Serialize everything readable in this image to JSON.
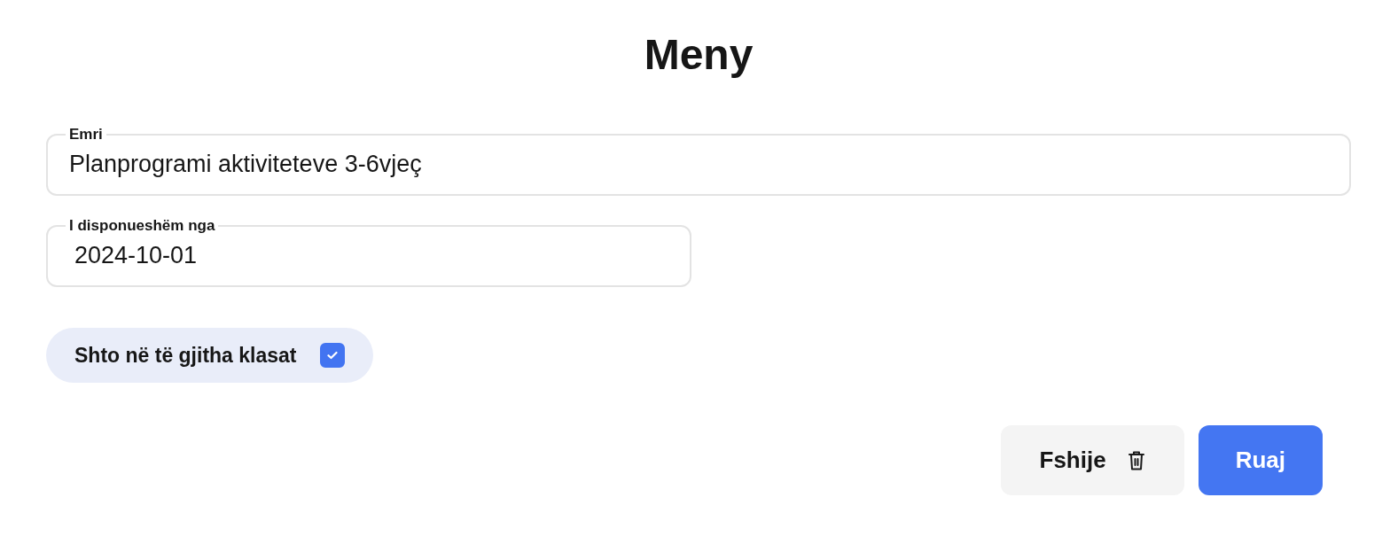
{
  "title": "Meny",
  "fields": [
    {
      "label": "Emri",
      "value": "Planprogrami aktiviteteve 3-6vjeç",
      "kind": "text"
    },
    {
      "label": "I disponueshëm nga",
      "value": "2024-10-01",
      "kind": "date"
    }
  ],
  "toggle": {
    "label": "Shto në të gjitha klasat",
    "checked": true
  },
  "buttons": [
    {
      "label": "Fshije",
      "kind": "delete"
    },
    {
      "label": "Ruaj",
      "kind": "primary"
    }
  ]
}
